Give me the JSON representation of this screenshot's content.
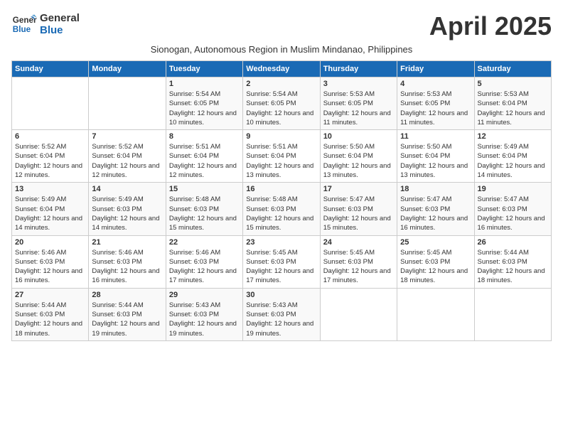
{
  "header": {
    "logo_line1": "General",
    "logo_line2": "Blue",
    "month_title": "April 2025",
    "subtitle": "Sionogan, Autonomous Region in Muslim Mindanao, Philippines"
  },
  "days_of_week": [
    "Sunday",
    "Monday",
    "Tuesday",
    "Wednesday",
    "Thursday",
    "Friday",
    "Saturday"
  ],
  "weeks": [
    [
      {
        "day": "",
        "info": ""
      },
      {
        "day": "",
        "info": ""
      },
      {
        "day": "1",
        "info": "Sunrise: 5:54 AM\nSunset: 6:05 PM\nDaylight: 12 hours and 10 minutes."
      },
      {
        "day": "2",
        "info": "Sunrise: 5:54 AM\nSunset: 6:05 PM\nDaylight: 12 hours and 10 minutes."
      },
      {
        "day": "3",
        "info": "Sunrise: 5:53 AM\nSunset: 6:05 PM\nDaylight: 12 hours and 11 minutes."
      },
      {
        "day": "4",
        "info": "Sunrise: 5:53 AM\nSunset: 6:05 PM\nDaylight: 12 hours and 11 minutes."
      },
      {
        "day": "5",
        "info": "Sunrise: 5:53 AM\nSunset: 6:04 PM\nDaylight: 12 hours and 11 minutes."
      }
    ],
    [
      {
        "day": "6",
        "info": "Sunrise: 5:52 AM\nSunset: 6:04 PM\nDaylight: 12 hours and 12 minutes."
      },
      {
        "day": "7",
        "info": "Sunrise: 5:52 AM\nSunset: 6:04 PM\nDaylight: 12 hours and 12 minutes."
      },
      {
        "day": "8",
        "info": "Sunrise: 5:51 AM\nSunset: 6:04 PM\nDaylight: 12 hours and 12 minutes."
      },
      {
        "day": "9",
        "info": "Sunrise: 5:51 AM\nSunset: 6:04 PM\nDaylight: 12 hours and 13 minutes."
      },
      {
        "day": "10",
        "info": "Sunrise: 5:50 AM\nSunset: 6:04 PM\nDaylight: 12 hours and 13 minutes."
      },
      {
        "day": "11",
        "info": "Sunrise: 5:50 AM\nSunset: 6:04 PM\nDaylight: 12 hours and 13 minutes."
      },
      {
        "day": "12",
        "info": "Sunrise: 5:49 AM\nSunset: 6:04 PM\nDaylight: 12 hours and 14 minutes."
      }
    ],
    [
      {
        "day": "13",
        "info": "Sunrise: 5:49 AM\nSunset: 6:04 PM\nDaylight: 12 hours and 14 minutes."
      },
      {
        "day": "14",
        "info": "Sunrise: 5:49 AM\nSunset: 6:03 PM\nDaylight: 12 hours and 14 minutes."
      },
      {
        "day": "15",
        "info": "Sunrise: 5:48 AM\nSunset: 6:03 PM\nDaylight: 12 hours and 15 minutes."
      },
      {
        "day": "16",
        "info": "Sunrise: 5:48 AM\nSunset: 6:03 PM\nDaylight: 12 hours and 15 minutes."
      },
      {
        "day": "17",
        "info": "Sunrise: 5:47 AM\nSunset: 6:03 PM\nDaylight: 12 hours and 15 minutes."
      },
      {
        "day": "18",
        "info": "Sunrise: 5:47 AM\nSunset: 6:03 PM\nDaylight: 12 hours and 16 minutes."
      },
      {
        "day": "19",
        "info": "Sunrise: 5:47 AM\nSunset: 6:03 PM\nDaylight: 12 hours and 16 minutes."
      }
    ],
    [
      {
        "day": "20",
        "info": "Sunrise: 5:46 AM\nSunset: 6:03 PM\nDaylight: 12 hours and 16 minutes."
      },
      {
        "day": "21",
        "info": "Sunrise: 5:46 AM\nSunset: 6:03 PM\nDaylight: 12 hours and 16 minutes."
      },
      {
        "day": "22",
        "info": "Sunrise: 5:46 AM\nSunset: 6:03 PM\nDaylight: 12 hours and 17 minutes."
      },
      {
        "day": "23",
        "info": "Sunrise: 5:45 AM\nSunset: 6:03 PM\nDaylight: 12 hours and 17 minutes."
      },
      {
        "day": "24",
        "info": "Sunrise: 5:45 AM\nSunset: 6:03 PM\nDaylight: 12 hours and 17 minutes."
      },
      {
        "day": "25",
        "info": "Sunrise: 5:45 AM\nSunset: 6:03 PM\nDaylight: 12 hours and 18 minutes."
      },
      {
        "day": "26",
        "info": "Sunrise: 5:44 AM\nSunset: 6:03 PM\nDaylight: 12 hours and 18 minutes."
      }
    ],
    [
      {
        "day": "27",
        "info": "Sunrise: 5:44 AM\nSunset: 6:03 PM\nDaylight: 12 hours and 18 minutes."
      },
      {
        "day": "28",
        "info": "Sunrise: 5:44 AM\nSunset: 6:03 PM\nDaylight: 12 hours and 19 minutes."
      },
      {
        "day": "29",
        "info": "Sunrise: 5:43 AM\nSunset: 6:03 PM\nDaylight: 12 hours and 19 minutes."
      },
      {
        "day": "30",
        "info": "Sunrise: 5:43 AM\nSunset: 6:03 PM\nDaylight: 12 hours and 19 minutes."
      },
      {
        "day": "",
        "info": ""
      },
      {
        "day": "",
        "info": ""
      },
      {
        "day": "",
        "info": ""
      }
    ]
  ]
}
